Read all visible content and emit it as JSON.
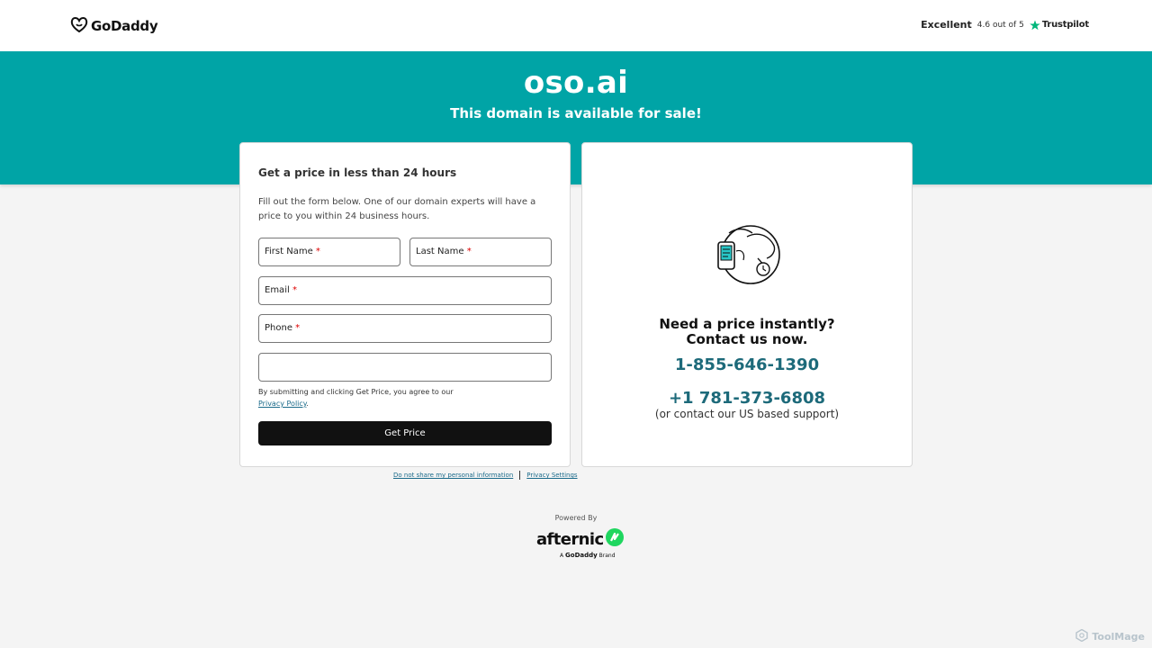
{
  "header": {
    "logo_text": "GoDaddy",
    "rating_word": "Excellent",
    "rating_score": "4.6 out of 5",
    "rating_provider": "Trustpilot"
  },
  "hero": {
    "domain": "oso.ai",
    "subtitle": "This domain is available for sale!"
  },
  "form": {
    "title": "Get a price in less than 24 hours",
    "description": "Fill out the form below. One of our domain experts will have a price to you within 24 business hours.",
    "first_name_label": "First Name",
    "last_name_label": "Last Name",
    "email_label": "Email",
    "phone_label": "Phone",
    "offer_value": "",
    "required_marker": "*",
    "agree_text": "By submitting and clicking Get Price, you agree to our",
    "privacy_link": "Privacy Policy",
    "agree_end": ".",
    "submit_label": "Get Price"
  },
  "contact": {
    "heading_line1": "Need a price instantly?",
    "heading_line2": "Contact us now.",
    "phone_primary": "1-855-646-1390",
    "phone_secondary": "+1 781-373-6808",
    "support_note": "(or contact our US based support)"
  },
  "footer": {
    "do_not_share": "Do not share my personal information",
    "privacy_settings": "Privacy Settings",
    "powered_by": "Powered By",
    "afternic_logo": "afternic",
    "brand_prefix": "A",
    "brand_name": "GoDaddy",
    "brand_suffix": "Brand"
  },
  "watermark": "ToolMage",
  "colors": {
    "hero_bg": "#00a4a6",
    "phone_text": "#1d6a7a",
    "button_bg": "#111111",
    "trustpilot_star": "#00b67a",
    "afternic_green": "#1fd65f"
  }
}
